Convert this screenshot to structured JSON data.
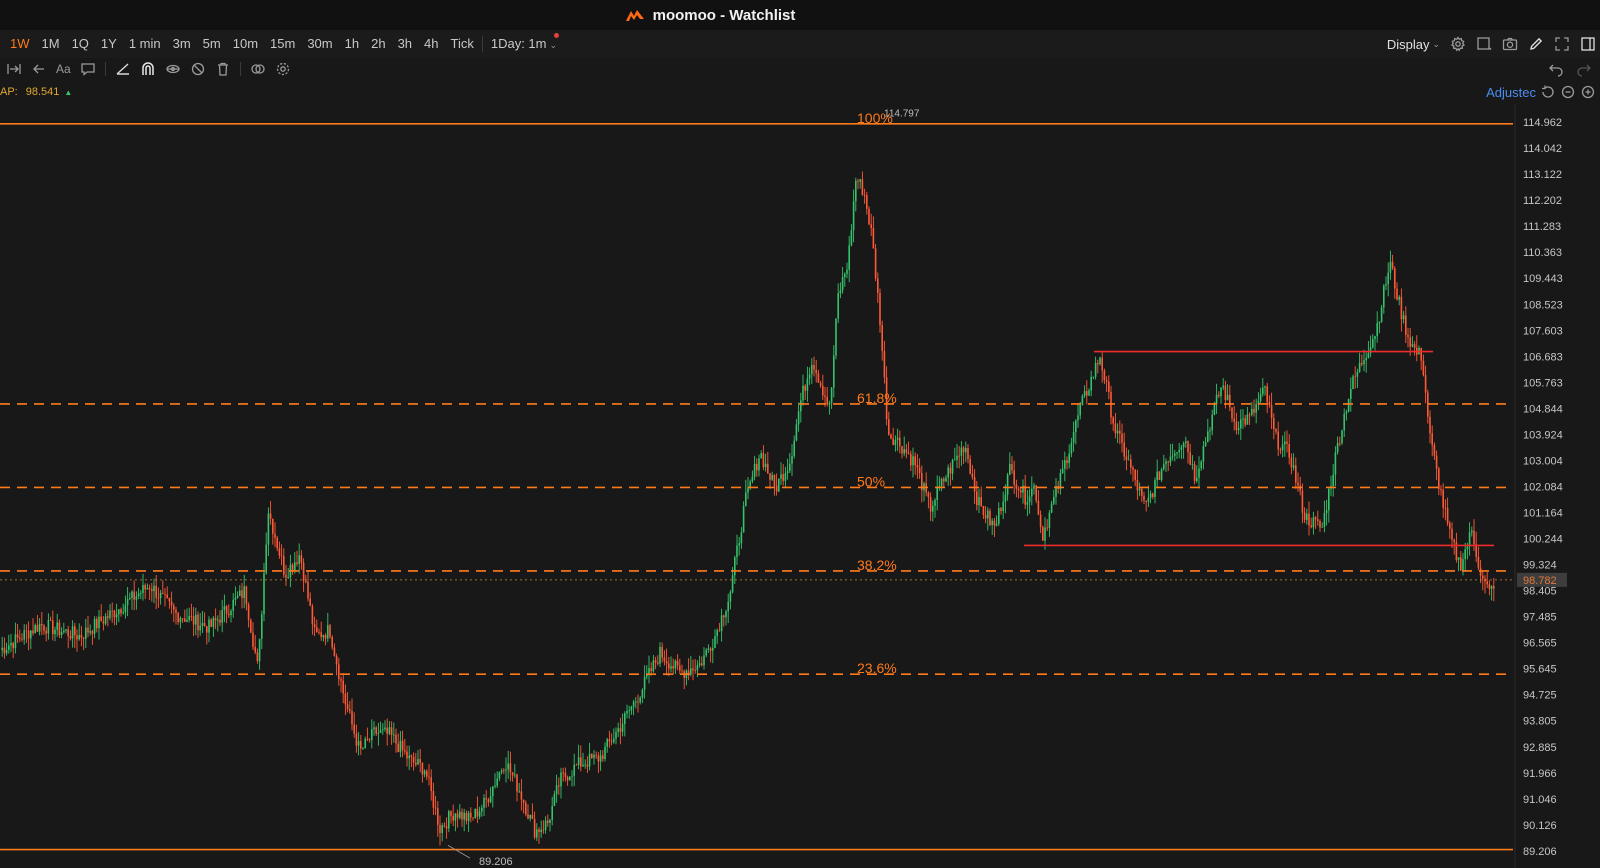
{
  "app": {
    "title": "moomoo - Watchlist"
  },
  "periods": [
    {
      "label": "1W",
      "active": true
    },
    {
      "label": "1M",
      "active": false
    },
    {
      "label": "1Q",
      "active": false
    },
    {
      "label": "1Y",
      "active": false
    },
    {
      "label": "1 min",
      "active": false
    },
    {
      "label": "3m",
      "active": false
    },
    {
      "label": "5m",
      "active": false
    },
    {
      "label": "10m",
      "active": false
    },
    {
      "label": "15m",
      "active": false
    },
    {
      "label": "30m",
      "active": false
    },
    {
      "label": "1h",
      "active": false
    },
    {
      "label": "2h",
      "active": false
    },
    {
      "label": "3h",
      "active": false
    },
    {
      "label": "4h",
      "active": false
    },
    {
      "label": "Tick",
      "active": false
    }
  ],
  "period_dropdown": "1Day: 1m",
  "display_label": "Display",
  "indicator": {
    "label": "AP:",
    "value": "98.541"
  },
  "adjusted_label": "Adjustec",
  "colors": {
    "accent": "#ff7a1a",
    "up": "#35c46b",
    "down": "#ff5a36",
    "fib": "#ff7a1a",
    "range": "#ee2b2b",
    "adjusted": "#4a8ef0"
  },
  "chart_data": {
    "type": "candlestick",
    "ylim": [
      88.6,
      115.6
    ],
    "y_ticks": [
      "114.962",
      "114.042",
      "113.122",
      "112.202",
      "111.283",
      "110.363",
      "109.443",
      "108.523",
      "107.603",
      "106.683",
      "105.763",
      "104.844",
      "103.924",
      "103.004",
      "102.084",
      "101.164",
      "100.244",
      "99.324",
      "98.405",
      "97.485",
      "96.565",
      "95.645",
      "94.725",
      "93.805",
      "92.885",
      "91.966",
      "91.046",
      "90.126",
      "89.206"
    ],
    "current_price": "98.782",
    "high_marker": "114.797",
    "low_marker": "89.206",
    "fib_levels": [
      {
        "label": "100%",
        "value": 114.9
      },
      {
        "label": "61.8%",
        "value": 105.0
      },
      {
        "label": "50%",
        "value": 102.05
      },
      {
        "label": "38.2%",
        "value": 99.1
      },
      {
        "label": "23.6%",
        "value": 95.45
      },
      {
        "label": "",
        "value": 89.25
      }
    ],
    "range_lines": [
      106.85,
      100.0
    ],
    "price_path": [
      [
        0,
        96.3
      ],
      [
        40,
        97.2
      ],
      [
        80,
        96.8
      ],
      [
        120,
        97.8
      ],
      [
        150,
        98.6
      ],
      [
        175,
        97.6
      ],
      [
        210,
        97.1
      ],
      [
        245,
        98.4
      ],
      [
        258,
        95.6
      ],
      [
        268,
        101.3
      ],
      [
        285,
        99.0
      ],
      [
        300,
        99.7
      ],
      [
        315,
        96.8
      ],
      [
        330,
        97.0
      ],
      [
        345,
        94.5
      ],
      [
        360,
        92.7
      ],
      [
        375,
        93.4
      ],
      [
        390,
        93.3
      ],
      [
        410,
        92.4
      ],
      [
        425,
        92.1
      ],
      [
        440,
        90.0
      ],
      [
        455,
        90.6
      ],
      [
        470,
        90.3
      ],
      [
        485,
        90.9
      ],
      [
        505,
        92.4
      ],
      [
        520,
        91.3
      ],
      [
        535,
        89.9
      ],
      [
        548,
        90.2
      ],
      [
        560,
        91.7
      ],
      [
        580,
        92.3
      ],
      [
        600,
        92.5
      ],
      [
        620,
        93.6
      ],
      [
        640,
        94.8
      ],
      [
        660,
        96.2
      ],
      [
        680,
        95.5
      ],
      [
        700,
        95.8
      ],
      [
        715,
        96.8
      ],
      [
        730,
        98.3
      ],
      [
        745,
        101.5
      ],
      [
        760,
        103.3
      ],
      [
        775,
        102.0
      ],
      [
        790,
        103.0
      ],
      [
        800,
        105.0
      ],
      [
        812,
        106.6
      ],
      [
        822,
        105.6
      ],
      [
        830,
        104.8
      ],
      [
        838,
        108.8
      ],
      [
        848,
        110.0
      ],
      [
        856,
        113.0
      ],
      [
        864,
        112.5
      ],
      [
        872,
        110.9
      ],
      [
        880,
        108.0
      ],
      [
        888,
        104.0
      ],
      [
        900,
        103.6
      ],
      [
        915,
        102.9
      ],
      [
        930,
        101.3
      ],
      [
        945,
        102.4
      ],
      [
        955,
        103.0
      ],
      [
        965,
        103.6
      ],
      [
        978,
        101.5
      ],
      [
        995,
        100.6
      ],
      [
        1010,
        102.7
      ],
      [
        1025,
        101.7
      ],
      [
        1035,
        102.1
      ],
      [
        1042,
        100.3
      ],
      [
        1060,
        102.3
      ],
      [
        1080,
        104.8
      ],
      [
        1100,
        106.7
      ],
      [
        1115,
        104.1
      ],
      [
        1130,
        102.8
      ],
      [
        1145,
        101.3
      ],
      [
        1165,
        103.0
      ],
      [
        1185,
        103.8
      ],
      [
        1195,
        102.4
      ],
      [
        1210,
        104.3
      ],
      [
        1222,
        105.7
      ],
      [
        1235,
        104.3
      ],
      [
        1250,
        104.5
      ],
      [
        1265,
        105.5
      ],
      [
        1275,
        103.8
      ],
      [
        1290,
        103.2
      ],
      [
        1305,
        101.0
      ],
      [
        1322,
        100.6
      ],
      [
        1338,
        103.6
      ],
      [
        1350,
        105.5
      ],
      [
        1362,
        106.5
      ],
      [
        1376,
        107.6
      ],
      [
        1390,
        110.0
      ],
      [
        1400,
        108.4
      ],
      [
        1408,
        107.4
      ],
      [
        1416,
        106.8
      ],
      [
        1422,
        106.7
      ],
      [
        1430,
        103.8
      ],
      [
        1440,
        102.0
      ],
      [
        1450,
        100.3
      ],
      [
        1460,
        99.3
      ],
      [
        1472,
        100.5
      ],
      [
        1482,
        98.8
      ],
      [
        1490,
        98.3
      ],
      [
        1495,
        98.8
      ]
    ]
  }
}
